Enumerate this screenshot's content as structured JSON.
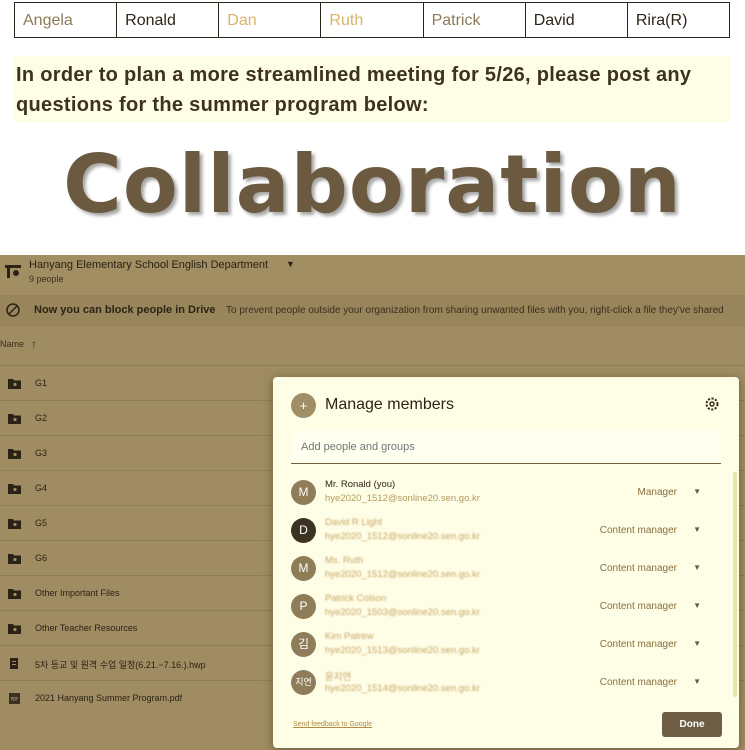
{
  "names_row": [
    "Angela",
    "Ronald",
    "Dan",
    "Ruth",
    "Patrick",
    "David",
    "Rira(R)"
  ],
  "question": "In order to plan a more streamlined meeting for 5/26, please post any questions for the summer program below:",
  "big_title": "Collaboration",
  "drive": {
    "department": "Hanyang Elementary School English Department",
    "member_count": "9 people",
    "notice_bold": "Now you can block people in Drive",
    "notice_text": "To prevent people outside your organization from sharing unwanted files with you, right-click a file they've shared",
    "sort_label": "Name",
    "sort_arrow": "↑",
    "files": [
      {
        "name": "G1",
        "icon": "shared-folder-icon"
      },
      {
        "name": "G2",
        "icon": "shared-folder-icon"
      },
      {
        "name": "G3",
        "icon": "shared-folder-icon"
      },
      {
        "name": "G4",
        "icon": "shared-folder-icon"
      },
      {
        "name": "G5",
        "icon": "shared-folder-icon"
      },
      {
        "name": "G6",
        "icon": "shared-folder-icon"
      },
      {
        "name": "Other Important Files",
        "icon": "shared-folder-icon"
      },
      {
        "name": "Other Teacher Resources",
        "icon": "shared-folder-icon"
      },
      {
        "name": "5차 등교 및 원격 수업 일정(6.21.~7.16.).hwp",
        "icon": "document-icon"
      },
      {
        "name": "2021 Hanyang Summer Program.pdf",
        "icon": "pdf-icon"
      }
    ]
  },
  "dialog": {
    "title": "Manage members",
    "add_placeholder": "Add people and groups",
    "members": [
      {
        "initial": "M",
        "name": "Mr. Ronald (you)",
        "email": "hye2020_1512@sonline20.sen.go.kr",
        "role": "Manager"
      },
      {
        "initial": "D",
        "name": "David R Light",
        "email": "hye2020_1512@sonline20.sen.go.kr",
        "role": "Content manager"
      },
      {
        "initial": "M",
        "name": "Ms. Ruth",
        "email": "hye2020_1512@sonline20.sen.go.kr",
        "role": "Content manager"
      },
      {
        "initial": "P",
        "name": "Patrick Colson",
        "email": "hye2020_1503@sonline20.sen.go.kr",
        "role": "Content manager"
      },
      {
        "initial": "김",
        "name": "Kim Patrew",
        "email": "hye2020_1513@sonline20.sen.go.kr",
        "role": "Content manager"
      },
      {
        "initial": "지연",
        "name": "윤지연",
        "email": "hye2020_1514@sonline20.sen.go.kr",
        "role": "Content manager"
      }
    ],
    "feedback_link": "Send feedback to Google",
    "done_label": "Done"
  }
}
